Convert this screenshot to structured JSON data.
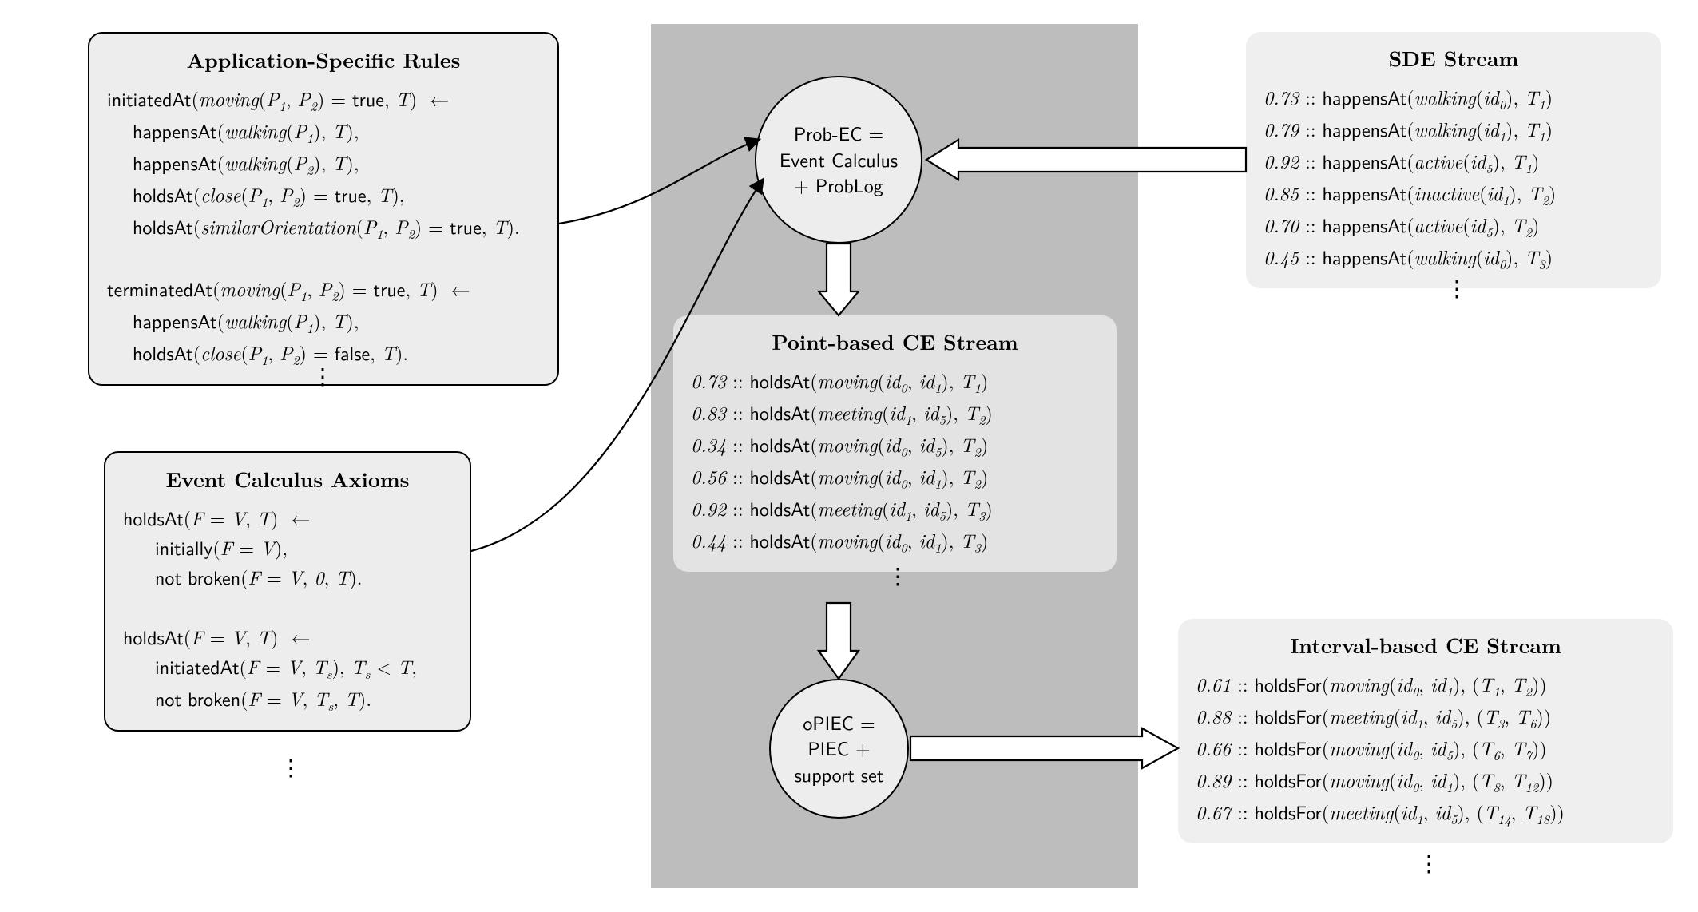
{
  "boxes": {
    "rules": {
      "title": "Application-Specific Rules"
    },
    "axioms": {
      "title": "Event Calculus Axioms"
    },
    "sde": {
      "title": "SDE Stream",
      "lines": [
        {
          "p": "0.73",
          "pred": "happensAt",
          "fluent": "walking",
          "args": [
            "id",
            "0"
          ],
          "t": "T",
          "tsub": "1"
        },
        {
          "p": "0.79",
          "pred": "happensAt",
          "fluent": "walking",
          "args": [
            "id",
            "1"
          ],
          "t": "T",
          "tsub": "1"
        },
        {
          "p": "0.92",
          "pred": "happensAt",
          "fluent": "active",
          "args": [
            "id",
            "5"
          ],
          "t": "T",
          "tsub": "1"
        },
        {
          "p": "0.85",
          "pred": "happensAt",
          "fluent": "inactive",
          "args": [
            "id",
            "1"
          ],
          "t": "T",
          "tsub": "2"
        },
        {
          "p": "0.70",
          "pred": "happensAt",
          "fluent": "active",
          "args": [
            "id",
            "5"
          ],
          "t": "T",
          "tsub": "2"
        },
        {
          "p": "0.45",
          "pred": "happensAt",
          "fluent": "walking",
          "args": [
            "id",
            "0"
          ],
          "t": "T",
          "tsub": "3"
        }
      ]
    },
    "point": {
      "title": "Point-based CE Stream",
      "lines": [
        {
          "p": "0.73",
          "pred": "holdsAt",
          "fluent": "moving",
          "a1": "0",
          "a2": "1",
          "tsub": "1"
        },
        {
          "p": "0.83",
          "pred": "holdsAt",
          "fluent": "meeting",
          "a1": "1",
          "a2": "5",
          "tsub": "2"
        },
        {
          "p": "0.34",
          "pred": "holdsAt",
          "fluent": "moving",
          "a1": "0",
          "a2": "5",
          "tsub": "2"
        },
        {
          "p": "0.56",
          "pred": "holdsAt",
          "fluent": "moving",
          "a1": "0",
          "a2": "1",
          "tsub": "2"
        },
        {
          "p": "0.92",
          "pred": "holdsAt",
          "fluent": "meeting",
          "a1": "1",
          "a2": "5",
          "tsub": "3"
        },
        {
          "p": "0.44",
          "pred": "holdsAt",
          "fluent": "moving",
          "a1": "0",
          "a2": "1",
          "tsub": "3"
        }
      ]
    },
    "interval": {
      "title": "Interval-based CE Stream",
      "lines": [
        {
          "p": "0.61",
          "pred": "holdsFor",
          "fluent": "moving",
          "a1": "0",
          "a2": "1",
          "t1": "1",
          "t2": "2"
        },
        {
          "p": "0.88",
          "pred": "holdsFor",
          "fluent": "meeting",
          "a1": "1",
          "a2": "5",
          "t1": "3",
          "t2": "6"
        },
        {
          "p": "0.66",
          "pred": "holdsFor",
          "fluent": "moving",
          "a1": "0",
          "a2": "5",
          "t1": "6",
          "t2": "7"
        },
        {
          "p": "0.89",
          "pred": "holdsFor",
          "fluent": "moving",
          "a1": "0",
          "a2": "1",
          "t1": "8",
          "t2": "12"
        },
        {
          "p": "0.67",
          "pred": "holdsFor",
          "fluent": "meeting",
          "a1": "1",
          "a2": "5",
          "t1": "14",
          "t2": "18"
        }
      ]
    }
  },
  "circles": {
    "probec": {
      "line1": "Prob-EC =",
      "line2": "Event Calculus",
      "line3": "+ ProbLog"
    },
    "opiec": {
      "line1": "oPIEC =",
      "line2": "PIEC +",
      "line3": "support set"
    }
  },
  "rules_text": {
    "l1a": "initiatedAt",
    "l1b": "moving",
    "l1c": "P",
    "l1d": "P",
    "l1e": "true",
    "l1f": "T",
    "l2a": "happensAt",
    "l2b": "walking",
    "l2c": "P",
    "l2d": "T",
    "l3a": "happensAt",
    "l3b": "walking",
    "l3c": "P",
    "l3d": "T",
    "l4a": "holdsAt",
    "l4b": "close",
    "l4c": "P",
    "l4d": "P",
    "l4e": "true",
    "l4f": "T",
    "l5a": "holdsAt",
    "l5b": "similarOrientation",
    "l5c": "P",
    "l5d": "P",
    "l5e": "true",
    "l5f": "T",
    "l6a": "terminatedAt",
    "l6b": "moving",
    "l6c": "P",
    "l6d": "P",
    "l6e": "true",
    "l6f": "T",
    "l7a": "happensAt",
    "l7b": "walking",
    "l7c": "P",
    "l7d": "T",
    "l8a": "holdsAt",
    "l8b": "close",
    "l8c": "P",
    "l8d": "P",
    "l8e": "false",
    "l8f": "T"
  },
  "axioms_text": {
    "l1": "holdsAt",
    "l2": "initially",
    "l3": "broken",
    "l4": "holdsAt",
    "l5": "initiatedAt",
    "l6": "broken",
    "F": "F",
    "V": "V",
    "T": "T",
    "Ts": "T",
    "zero": "0",
    "not": "not"
  }
}
